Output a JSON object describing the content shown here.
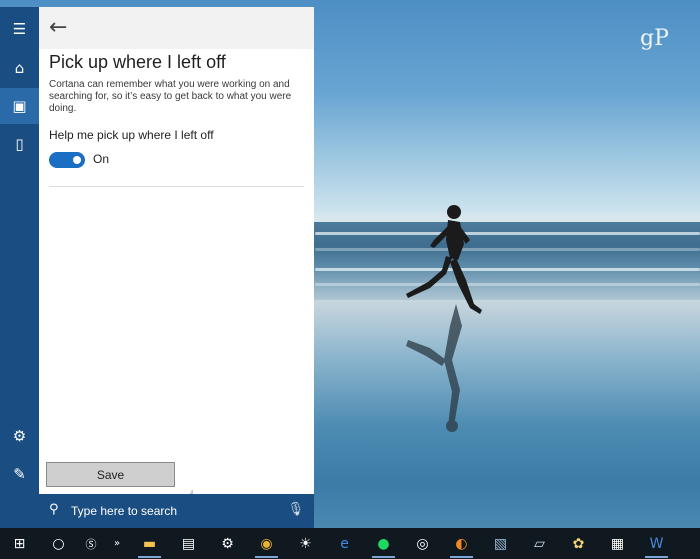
{
  "settings": {
    "title": "Pick up where I left off",
    "description": "Cortana can remember what you were working on and searching for, so it’s easy to get back to what you were doing.",
    "toggle_label": "Help me pick up where I left off",
    "toggle_state": "On",
    "save_label": "Save"
  },
  "search": {
    "placeholder": "Type here to search"
  },
  "watermark": "gP",
  "icons": {
    "rail": [
      "menu-icon",
      "home-icon",
      "notebook-icon",
      "devices-icon",
      "gear-icon",
      "feedback-icon"
    ],
    "taskbar": [
      "windows-start-icon",
      "cortana-circle-icon",
      "skype-icon",
      "more-icon",
      "file-explorer-icon",
      "store-icon",
      "settings-icon",
      "chrome-icon",
      "weather-icon",
      "edge-icon",
      "spotify-icon",
      "groove-icon",
      "firefox-icon",
      "photo-icon",
      "notes-icon",
      "paint-icon",
      "calendar-icon",
      "word-icon"
    ]
  },
  "colors": {
    "accent": "#1a6fc4",
    "rail": "#1a4e82",
    "taskbar": "#101820"
  }
}
